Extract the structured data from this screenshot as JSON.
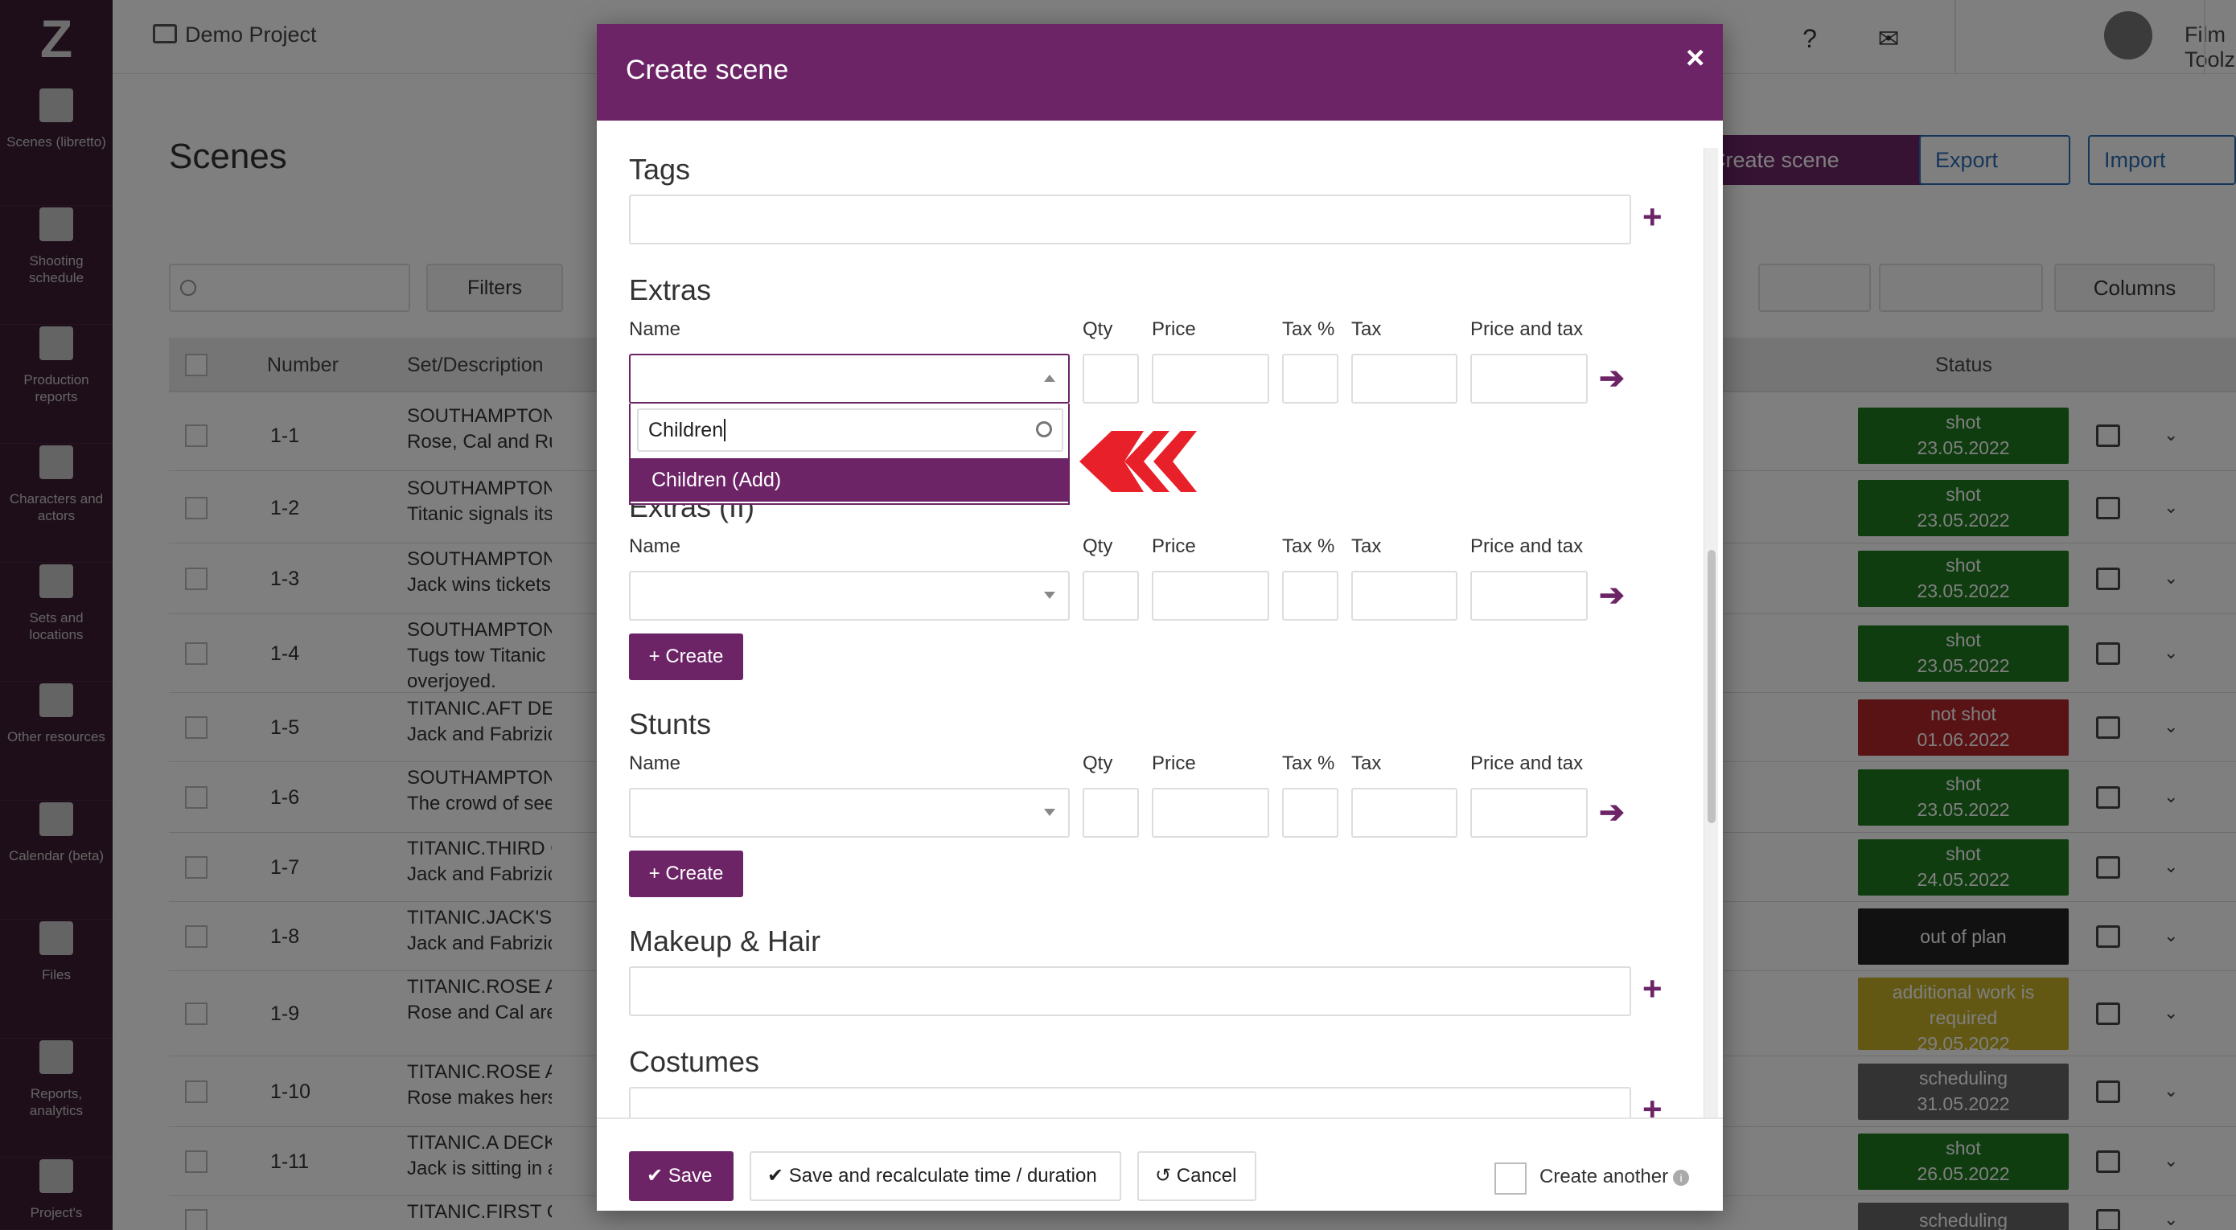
{
  "app": {
    "project_name": "Demo Project",
    "user_name": "Film Toolz"
  },
  "sidebar": {
    "items": [
      {
        "label": "Scenes (libretto)",
        "icon": "clapperboard-icon"
      },
      {
        "label": "Shooting schedule",
        "icon": "calendar-icon"
      },
      {
        "label": "Production reports",
        "icon": "checkbox-icon"
      },
      {
        "label": "Characters and actors",
        "icon": "people-icon"
      },
      {
        "label": "Sets and locations",
        "icon": "image-icon"
      },
      {
        "label": "Other resources",
        "icon": "box-icon"
      },
      {
        "label": "Calendar (beta)",
        "icon": "calendar-icon"
      },
      {
        "label": "Files",
        "icon": "file-icon"
      },
      {
        "label": "Reports, analytics",
        "icon": "bar-chart-icon"
      },
      {
        "label": "Project's",
        "icon": "sliders-icon"
      }
    ]
  },
  "page": {
    "title": "Scenes",
    "filters_label": "Filters",
    "create_scene_label": "Create scene",
    "export_label": "Export",
    "import_label": "Import",
    "columns_label": "Columns"
  },
  "table": {
    "headers": {
      "number": "Number",
      "set": "Set/Description",
      "status": "Status"
    },
    "rows": [
      {
        "num": "1-1",
        "set": "SOUTHAMPTON.DOC",
        "desc": "Rose, Cal and Ruth arr",
        "status": "shot",
        "date": "23.05.2022",
        "status_type": "shot"
      },
      {
        "num": "1-2",
        "set": "SOUTHAMPTON.DOC",
        "desc": "Titanic signals its imm",
        "status": "shot",
        "date": "23.05.2022",
        "status_type": "shot"
      },
      {
        "num": "1-3",
        "set": "SOUTHAMPTON.PUB",
        "desc": "Jack wins tickets to T",
        "status": "shot",
        "date": "23.05.2022",
        "status_type": "shot"
      },
      {
        "num": "1-4",
        "set": "SOUTHAMPTON.DOC",
        "desc": "Tugs tow Titanic away",
        "desc2": "overjoyed.",
        "status": "shot",
        "date": "23.05.2022",
        "status_type": "shot"
      },
      {
        "num": "1-5",
        "set": "TITANIC.AFT DECK",
        "desc": "Jack and Fabrizio boa",
        "status": "not shot",
        "date": "01.06.2022",
        "status_type": "notshot"
      },
      {
        "num": "1-6",
        "set": "SOUTHAMPTON.DOC",
        "desc": "The crowd of seer-offs",
        "status": "shot",
        "date": "23.05.2022",
        "status_type": "shot"
      },
      {
        "num": "1-7",
        "set": "TITANIC.THIRD CLASS",
        "desc": "Jack and Fabrizio are",
        "status": "shot",
        "date": "24.05.2022",
        "status_type": "shot"
      },
      {
        "num": "1-8",
        "set": "TITANIC.JACK'S SUITE",
        "desc": "Jack and Fabrizio find",
        "status": "out of plan",
        "date": "",
        "status_type": "outplan"
      },
      {
        "num": "1-9",
        "set": "TITANIC.ROSE AND C",
        "desc": "Rose and Cal are havin",
        "status": "additional work is required",
        "date": "29.05.2022",
        "status_type": "add"
      },
      {
        "num": "1-10",
        "set": "TITANIC.ROSE AND C",
        "desc": "Rose makes herself co",
        "status": "scheduling",
        "date": "31.05.2022",
        "status_type": "sched"
      },
      {
        "num": "1-11",
        "set": "TITANIC.A DECK PRO",
        "desc": "Jack is sitting in a dec",
        "status": "shot",
        "date": "26.05.2022",
        "status_type": "shot"
      },
      {
        "num": "",
        "set": "TITANIC.FIRST CLASS RECEPTION",
        "desc": "",
        "status": "scheduling",
        "date": "",
        "status_type": "sched"
      }
    ]
  },
  "modal": {
    "title": "Create scene",
    "close_label": "×",
    "sections": {
      "tags": "Tags",
      "extras": "Extras",
      "extras2": "Extras (II)",
      "stunts": "Stunts",
      "makeup": "Makeup & Hair",
      "costumes": "Costumes"
    },
    "columns": {
      "name": "Name",
      "qty": "Qty",
      "price": "Price",
      "tax_pct": "Tax %",
      "tax": "Tax",
      "price_tax": "Price and tax"
    },
    "create_label": "Create",
    "dropdown": {
      "search_value": "Children",
      "option": "Children (Add)"
    },
    "footer": {
      "save": "Save",
      "save_recalc": "Save and recalculate time / duration",
      "cancel": "Cancel",
      "create_another": "Create another"
    }
  },
  "colors": {
    "brand_purple": "#6c2467",
    "sidebar_bg": "#3c1c33",
    "status_shot": "#1e7a1e",
    "status_not_shot": "#b3262b",
    "pointer_red": "#e8202a"
  }
}
